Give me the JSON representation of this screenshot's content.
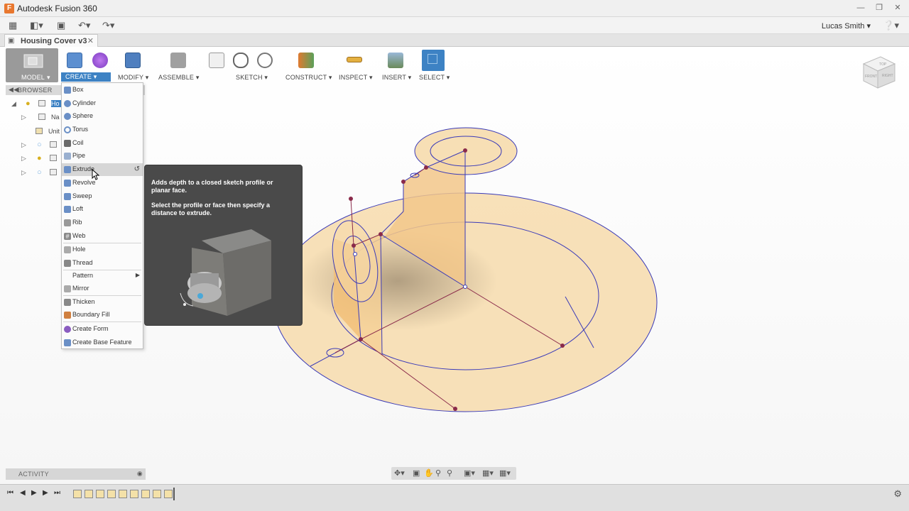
{
  "window": {
    "title": "Autodesk Fusion 360",
    "controls": [
      "minimize-icon",
      "restore-icon",
      "close-icon"
    ]
  },
  "qat": {
    "user": "Lucas Smith",
    "icons": [
      "apps-grid-icon",
      "file-icon",
      "save-icon",
      "undo-icon",
      "redo-icon",
      "help-icon"
    ]
  },
  "document": {
    "tab_title": "Housing Cover v3"
  },
  "toolbar": {
    "model": "MODEL",
    "create": "CREATE",
    "modify": "MODIFY",
    "assemble": "ASSEMBLE",
    "sketch": "SKETCH",
    "construct": "CONSTRUCT",
    "inspect": "INSPECT",
    "insert": "INSERT",
    "select": "SELECT"
  },
  "browser": {
    "header": "BROWSER",
    "rows": [
      {
        "label": "Ho"
      },
      {
        "label": "Na"
      },
      {
        "label": "Unit"
      },
      {
        "label": ""
      },
      {
        "label": ""
      },
      {
        "label": ""
      }
    ]
  },
  "create_menu": {
    "items": [
      {
        "label": "Box",
        "color": "#6a8fc6"
      },
      {
        "label": "Cylinder",
        "color": "#6a8fc6"
      },
      {
        "label": "Sphere",
        "color": "#6a8fc6"
      },
      {
        "label": "Torus",
        "color": "#6a8fc6"
      },
      {
        "label": "Coil",
        "color": "#6a8fc6"
      },
      {
        "label": "Pipe",
        "color": "#6a8fc6"
      },
      {
        "label": "Extrude",
        "color": "#6a8fc6"
      },
      {
        "label": "Revolve",
        "color": "#6a8fc6"
      },
      {
        "label": "Sweep",
        "color": "#6a8fc6"
      },
      {
        "label": "Loft",
        "color": "#6a8fc6"
      },
      {
        "label": "Rib",
        "color": "#888888"
      },
      {
        "label": "Web",
        "color": "#888888"
      },
      {
        "label": "Hole",
        "color": "#888888"
      },
      {
        "label": "Thread",
        "color": "#888888"
      },
      {
        "label": "Pattern",
        "color": ""
      },
      {
        "label": "Mirror",
        "color": "#888888"
      },
      {
        "label": "Thicken",
        "color": "#888888"
      },
      {
        "label": "Boundary Fill",
        "color": "#d08040"
      },
      {
        "label": "Create Form",
        "color": "#8a5cc0"
      },
      {
        "label": "Create Base Feature",
        "color": "#6a8fc6"
      }
    ]
  },
  "tooltip": {
    "line1": "Adds depth to a closed sketch profile or planar face.",
    "line2": "Select the profile or face then specify a distance to extrude."
  },
  "viewcube": {
    "top": "TOP",
    "front": "FRONT",
    "right": "RIGHT"
  },
  "activity": {
    "label": "ACTIVITY"
  },
  "colors": {
    "accent": "#3d82c4",
    "sketch_fill": "#f6d9a8",
    "sketch_line": "#3a3ab8",
    "sketch_point": "#8a2a4a"
  }
}
